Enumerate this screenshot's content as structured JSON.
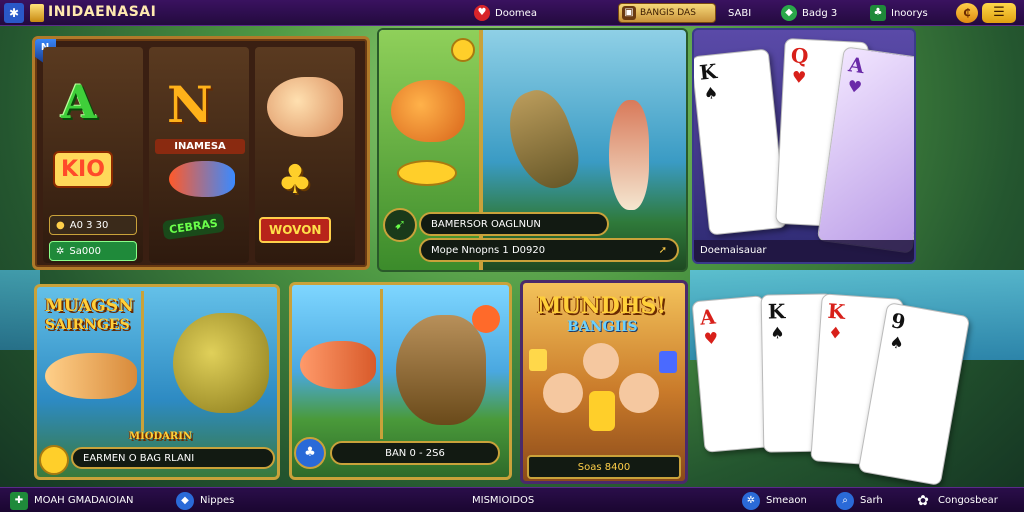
{
  "topbar": {
    "logo_icon": "asterisk-logo-icon",
    "title": "INIDAENASAI",
    "notifications_label": "Doomea",
    "balance_label": "BANGIS DAS",
    "user_label": "SABI",
    "badge_label": "Badg 3",
    "profile_label": "Inoorys",
    "menu_icon": "hamburger-icon",
    "coin_icon": "coin-icon"
  },
  "slot_game": {
    "reel1_symbol_top": "A",
    "reel1_symbol_mid": "KIO",
    "reel1_bet_label": "A0 3 30",
    "reel1_button_label": "Sa000",
    "reel2_symbol_top": "N",
    "reel2_label": "INAMESA",
    "reel3_badge_mid": "CEBRAS",
    "reel3_badge_bottom": "WOVON"
  },
  "fishing_game": {
    "title_bar": "BAMERSOR OAGLNUN",
    "info_bar": "Mope Nnopns 1 D0920"
  },
  "cards_game": {
    "footer_label": "Doemaisauar",
    "card1_rank": "K",
    "card2_rank": "Q",
    "card3_rank": "A"
  },
  "fish_game2": {
    "title_line1": "MUAGSN",
    "title_line2": "SAIRNGES",
    "subtitle": "MIODARIN",
    "info_bar": "EARMEN O BAG RLANI"
  },
  "fish_game3": {
    "info_bar": "BAN 0 - 2S6"
  },
  "mahjong_game": {
    "title_line1": "MUNDHS!",
    "title_line2": "BANGIIS",
    "info_bar": "Soas 8400"
  },
  "cards_game2": {
    "ranks": [
      "A",
      "K",
      "K",
      "9"
    ]
  },
  "bottombar": {
    "left_label": "MOAH GMADAIOIAN",
    "left2_label": "Nippes",
    "center_label": "MISMIOIDOS",
    "right1_label": "Smeaon",
    "right2_label": "Sarh",
    "right3_label": "Congosbear"
  },
  "colors": {
    "topbar": "#230a3e",
    "accent_gold": "#c9a23a",
    "bottombar": "#1a0630"
  }
}
